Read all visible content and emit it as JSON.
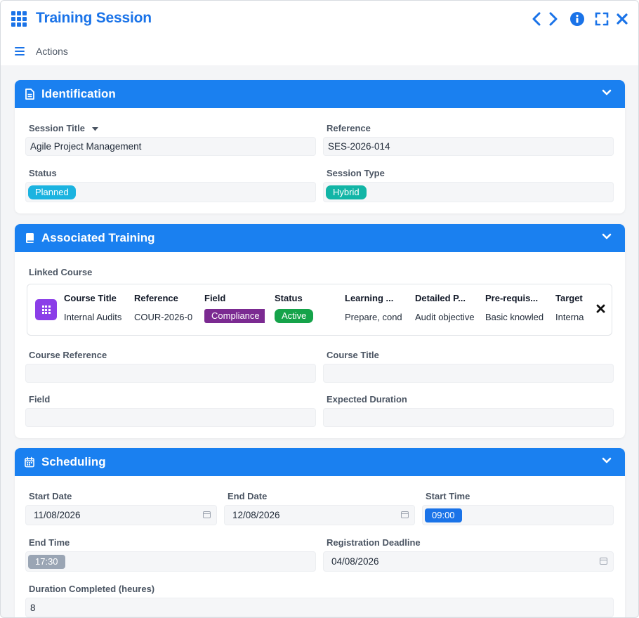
{
  "app": {
    "title": "Training Session",
    "actions_label": "Actions",
    "accent": "#1a73e8"
  },
  "sections": {
    "identification": {
      "title": "Identification",
      "icon": "document-icon",
      "session_title_label": "Session Title",
      "session_title_value": "Agile Project Management",
      "reference_label": "Reference",
      "reference_value": "SES-2026-014",
      "status_label": "Status",
      "status_value": "Planned",
      "status_color": "#1bb3e0",
      "session_type_label": "Session Type",
      "session_type_value": "Hybrid",
      "session_type_color": "#12b5a6"
    },
    "associated_training": {
      "title": "Associated Training",
      "icon": "book-icon",
      "linked_course_label": "Linked Course",
      "course_columns": [
        {
          "header": "Course Title",
          "value": "Internal Audits"
        },
        {
          "header": "Reference",
          "value": "COUR-2026-0"
        },
        {
          "header": "Field",
          "value": "Compliance"
        },
        {
          "header": "Status",
          "value": "Active"
        },
        {
          "header": "Learning ...",
          "value": "Prepare, cond"
        },
        {
          "header": "Detailed P...",
          "value": "Audit objective"
        },
        {
          "header": "Pre-requis...",
          "value": "Basic knowled"
        },
        {
          "header": "Target",
          "value": "Interna"
        }
      ],
      "field_pill_color": "#7b2a91",
      "status_pill_color": "#15a34a",
      "course_reference_label": "Course Reference",
      "course_title_label": "Course Title",
      "field_label": "Field",
      "expected_duration_label": "Expected Duration"
    },
    "scheduling": {
      "title": "Scheduling",
      "icon": "calendar-icon",
      "start_date_label": "Start Date",
      "start_date_value": "11/08/2026",
      "end_date_label": "End Date",
      "end_date_value": "12/08/2026",
      "start_time_label": "Start Time",
      "start_time_value": "09:00",
      "start_time_color": "#1a73e8",
      "end_time_label": "End Time",
      "end_time_value": "17:30",
      "end_time_color": "#9aa5b4",
      "registration_deadline_label": "Registration Deadline",
      "registration_deadline_value": "04/08/2026",
      "duration_completed_label": "Duration Completed (heures)",
      "duration_completed_value": "8"
    }
  }
}
